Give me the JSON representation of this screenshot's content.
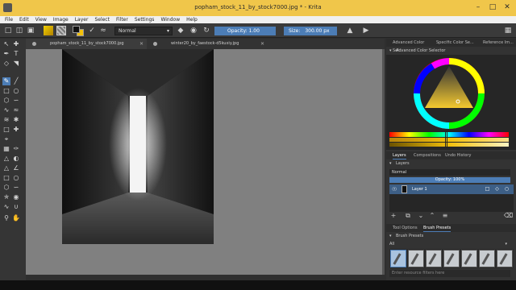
{
  "window": {
    "title": "popham_stock_11_by_stock7000.jpg * - Krita",
    "controls": [
      "minimize",
      "maximize",
      "close"
    ]
  },
  "menu": [
    "File",
    "Edit",
    "View",
    "Image",
    "Layer",
    "Select",
    "Filter",
    "Settings",
    "Window",
    "Help"
  ],
  "toolbar": {
    "blend_mode": "Normal",
    "opacity_label": "Opacity: 1.00",
    "size_label": "Size:",
    "size_value": "300.00 px"
  },
  "tabs": [
    {
      "label": "popham_stock_11_by_stock7000.jpg",
      "active": true
    },
    {
      "label": "winter20_by_faestock-d5kuxiy.jpg",
      "active": false
    }
  ],
  "dock": {
    "top_tabs": [
      "Advanced Color Sel...",
      "Specific Color Se...",
      "Reference Im..."
    ],
    "color_selector_title": "Advanced Color Selector",
    "layers_tabs": [
      "Layers",
      "Compositions",
      "Undo History"
    ],
    "layers_title": "Layers",
    "layer_blend": "Normal",
    "layer_opacity": "Opacity:  100%",
    "layers": [
      {
        "name": "Layer 1"
      }
    ],
    "bottom_tabs": [
      "Tool Options",
      "Brush Presets"
    ],
    "presets_title": "Brush Presets",
    "preset_filter": "All",
    "preset_search_placeholder": "Enter resource filters here"
  },
  "colors": {
    "titlebar": "#f0c64a",
    "accent": "#4c7db6",
    "foreground": "#111111",
    "background": "#f2c00b"
  }
}
